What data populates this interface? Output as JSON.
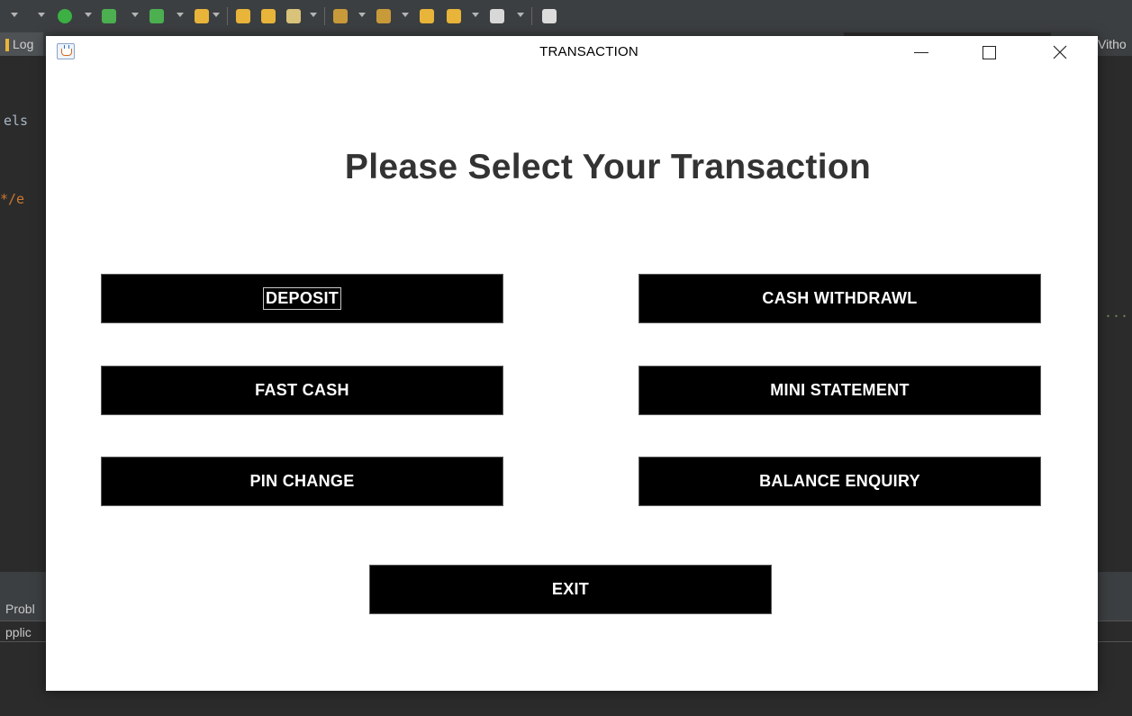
{
  "window": {
    "title": "TRANSACTION"
  },
  "heading": "Please Select Your Transaction",
  "buttons": {
    "deposit": "DEPOSIT",
    "cash_withdrawl": "CASH WITHDRAWL",
    "fast_cash": "FAST CASH",
    "mini_statement": "MINI STATEMENT",
    "pin_change": "PIN CHANGE",
    "balance_enquiry": "BALANCE ENQUIRY",
    "exit": "EXIT"
  },
  "background_ide": {
    "left_tab": "Log",
    "right_tab": "Vitho",
    "code_fragments": [
      "els",
      "*/e",
      "..."
    ],
    "bottom_tabs": [
      "Probl",
      "pplic"
    ]
  },
  "colors": {
    "dialog_bg": "#ffffff",
    "button_bg": "#000000",
    "button_text": "#ffffff",
    "heading_text": "#333333",
    "ide_bg": "#2b2b2b"
  }
}
